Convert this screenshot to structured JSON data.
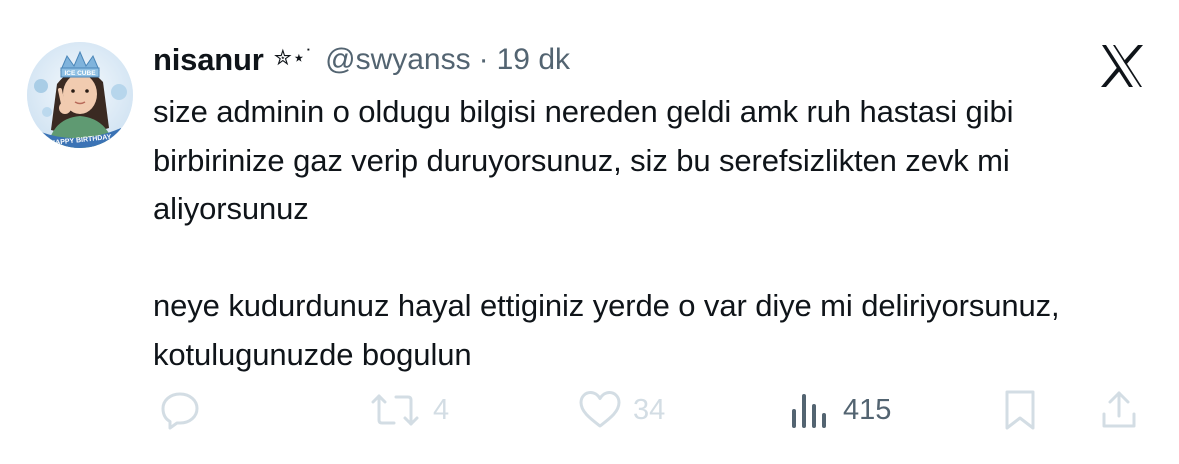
{
  "tweet": {
    "display_name": "nisanur",
    "name_decoration": "✮⋆˙",
    "handle": "@swyanss",
    "separator": "·",
    "time": "19 dk",
    "text": "size adminin o oldugu bilgisi nereden geldi amk ruh hastasi gibi birbirinize gaz verip duruyorsunuz, siz bu serefsizlikten zevk mi aliyorsunuz\n\nneye kudurdunuz hayal ettiginiz yerde o var diye mi deliriyorsunuz, kotulugunuzde bogulun"
  },
  "avatar": {
    "crown_text": "ICE CUBE",
    "banner_text": "HAPPY BIRTHDAY"
  },
  "actions": {
    "reply": {
      "icon": "reply-icon",
      "count": ""
    },
    "repost": {
      "icon": "repost-icon",
      "count": "4"
    },
    "like": {
      "icon": "heart-icon",
      "count": "34"
    },
    "views": {
      "icon": "views-chart-icon",
      "count": "415"
    },
    "bookmark": {
      "icon": "bookmark-icon",
      "count": ""
    },
    "share": {
      "icon": "share-icon",
      "count": ""
    }
  },
  "brand": {
    "logo": "x-logo-icon"
  },
  "colors": {
    "text": "#0f1419",
    "secondary": "#536471",
    "faded": "#d3dde4"
  }
}
